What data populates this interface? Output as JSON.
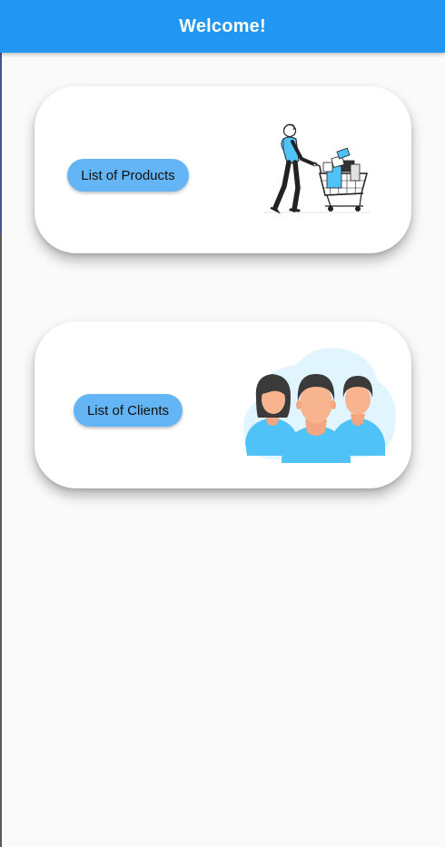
{
  "app_bar": {
    "title": "Welcome!"
  },
  "cards": [
    {
      "button_label": "List of Products",
      "illustration_icon": "shopping-cart-person-icon"
    },
    {
      "button_label": "List of Clients",
      "illustration_icon": "people-group-icon"
    }
  ],
  "colors": {
    "app_bar": "#2196f3",
    "button": "#64b5f6",
    "background": "#fafafa",
    "card": "#ffffff",
    "accent_cyan": "#4fc3f7"
  }
}
